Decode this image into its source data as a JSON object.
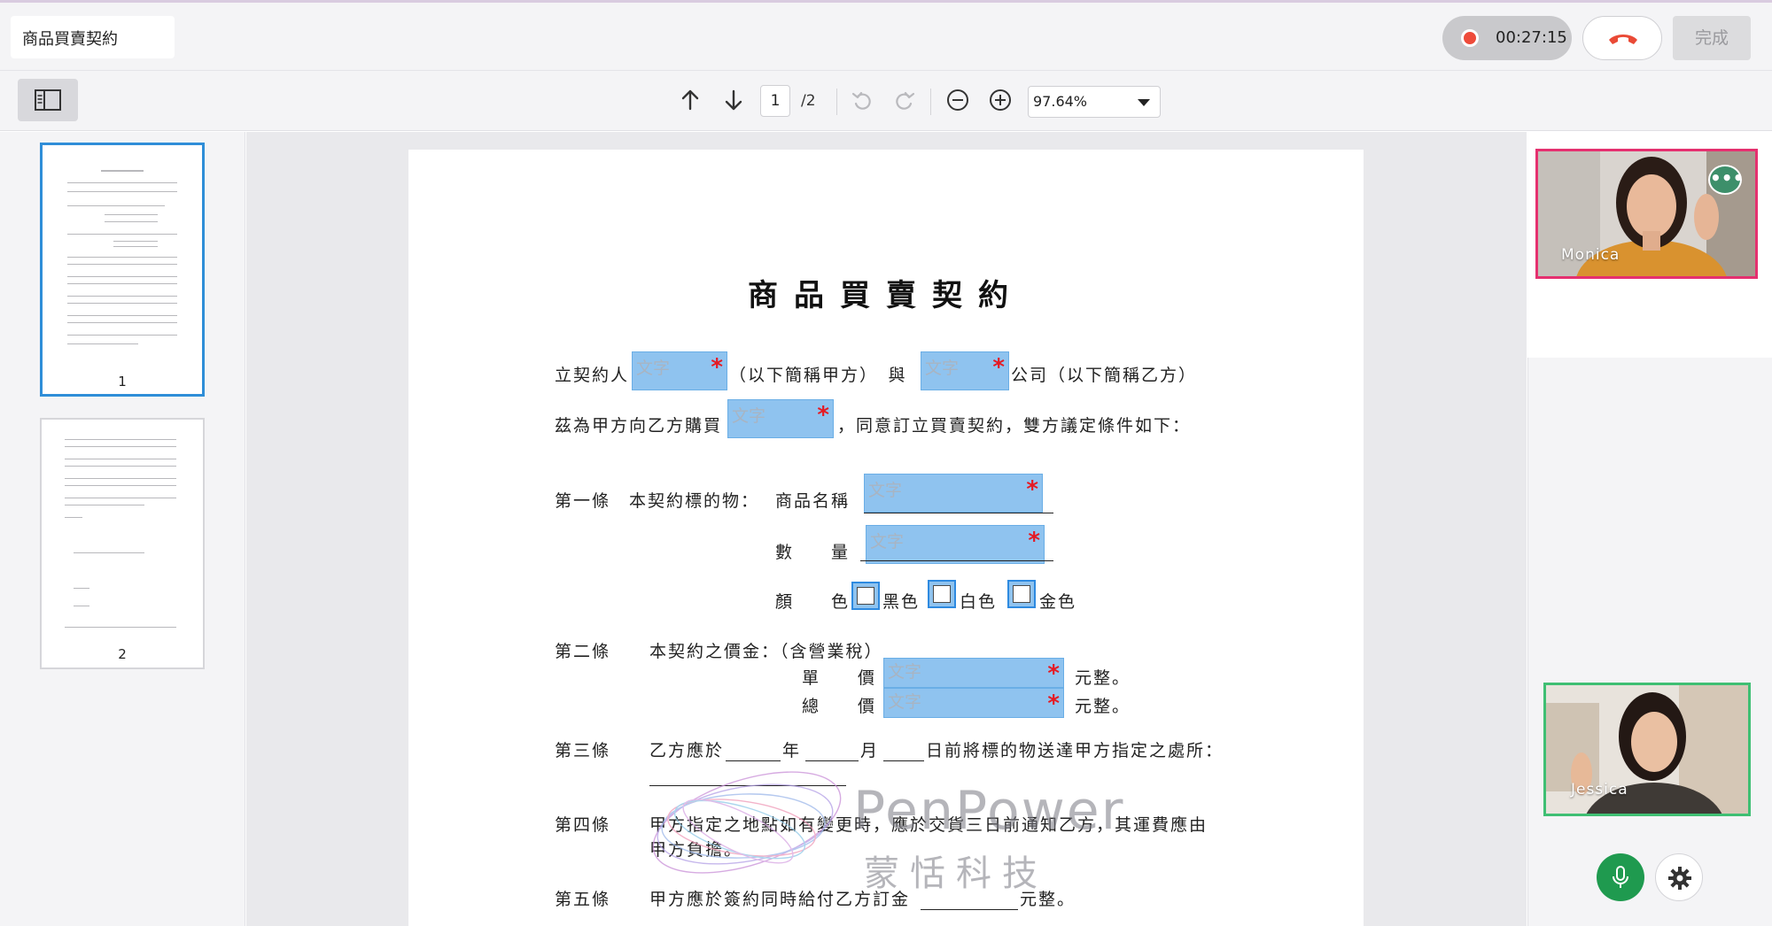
{
  "header": {
    "document_title": "商品買賣契約",
    "recording_time": "00:27:15",
    "done_label": "完成"
  },
  "toolbar": {
    "current_page": "1",
    "total_pages": "/2",
    "zoom": "97.64%"
  },
  "thumbnails": [
    {
      "label": "1"
    },
    {
      "label": "2"
    }
  ],
  "document": {
    "title": "商品買賣契約",
    "field_placeholder": "文字",
    "required_mark": "*",
    "line1_a": "立契約人",
    "line1_b": "（以下簡稱甲方）　與",
    "line1_c": "公司（以下簡稱乙方）",
    "line2_a": "茲為甲方向乙方購買",
    "line2_b": "，同意訂立買賣契約，雙方議定條件如下：",
    "art1_label": "第一條　本契約標的物：",
    "art1_name": "商品名稱",
    "art1_qty": "數　　量",
    "art1_color": "顏　　色",
    "color_black": "黑色",
    "color_white": "白色",
    "color_gold": "金色",
    "art2_label": "第二條",
    "art2_text": "本契約之價金：（含營業稅）",
    "art2_unit": "單　　價",
    "art2_total": "總　　價",
    "art2_suffix": "元整。",
    "art3_label": "第三條",
    "art3_a": "乙方應於",
    "art3_year": "年",
    "art3_month": "月",
    "art3_b": "日前將標的物送達甲方指定之處所：",
    "art4_label": "第四條",
    "art4_a": "甲方指定之地點如有變更時，應於交貨三日前通知乙方，其運費應由",
    "art4_b": "甲方負擔。",
    "art5_label": "第五條",
    "art5_text": "甲方應於簽約同時給付乙方訂金",
    "art5_suffix": "元整。",
    "watermark_en": "PenPower",
    "watermark_zh": "蒙恬科技"
  },
  "participants": [
    {
      "name": "Monica",
      "border_color": "#e5306f"
    },
    {
      "name": "Jessica",
      "border_color": "#3fbf73"
    }
  ],
  "icons": {
    "record": "record-dot-icon",
    "hangup": "phone-hangup-icon",
    "sidebar": "sidebar-toggle-icon",
    "up": "arrow-up-icon",
    "down": "arrow-down-icon",
    "undo": "undo-icon",
    "redo": "redo-icon",
    "zoom_out": "zoom-out-icon",
    "zoom_in": "zoom-in-icon",
    "mic": "microphone-icon",
    "gear": "gear-icon",
    "more": "more-dots-icon"
  },
  "colors": {
    "field_fill": "#8fc3ef",
    "required": "#e51a23",
    "record": "#ee4b3a",
    "active_thumb": "#2f8ed8",
    "mic_button": "#1f9a4f"
  }
}
